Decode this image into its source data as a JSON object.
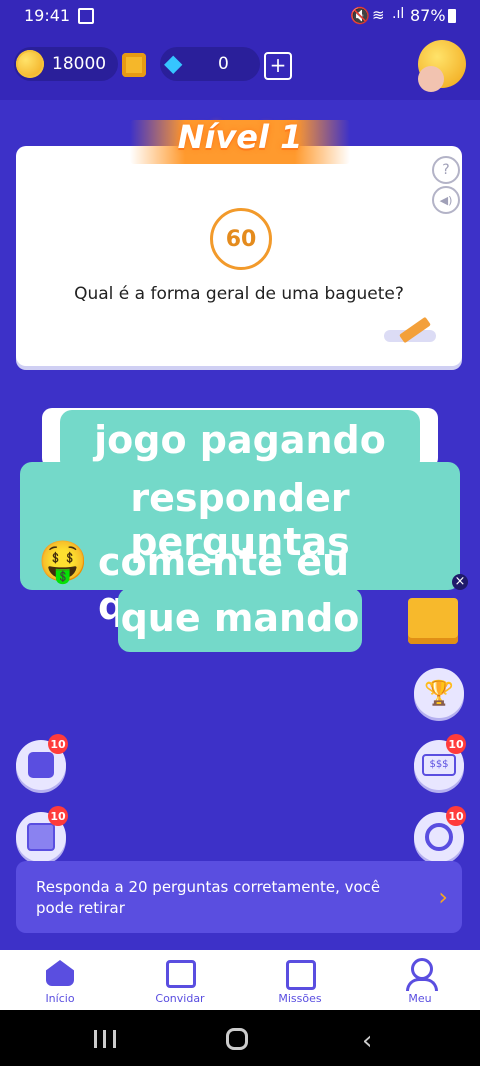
{
  "status_bar": {
    "time": "19:41",
    "battery": "87%"
  },
  "top_bar": {
    "coins": "18000",
    "gems": "0",
    "plus": "+"
  },
  "quiz": {
    "level_label": "Nível 1",
    "timer": "60",
    "question": "Qual é a forma geral de uma baguete?",
    "help_icon": "?"
  },
  "overlay": {
    "line1": "jogo pagando pra",
    "line2": "responder perguntas",
    "line3_emoji": "🤑",
    "line3_text": "comente eu quero",
    "line4": "que mando",
    "close": "×"
  },
  "badges": {
    "dice": "10",
    "puzzle": "10",
    "slot": "10",
    "wheel": "10"
  },
  "task": {
    "message": "Responda a 20 perguntas corretamente, você pode retirar",
    "arrow": "›"
  },
  "nav": [
    {
      "label": "Início"
    },
    {
      "label": "Convidar"
    },
    {
      "label": "Missões"
    },
    {
      "label": "Meu"
    }
  ],
  "colors": {
    "background": "#3d31c8",
    "accent": "#5a4ee0",
    "caption": "#74d9c9",
    "badge": "#ff3b3b"
  }
}
